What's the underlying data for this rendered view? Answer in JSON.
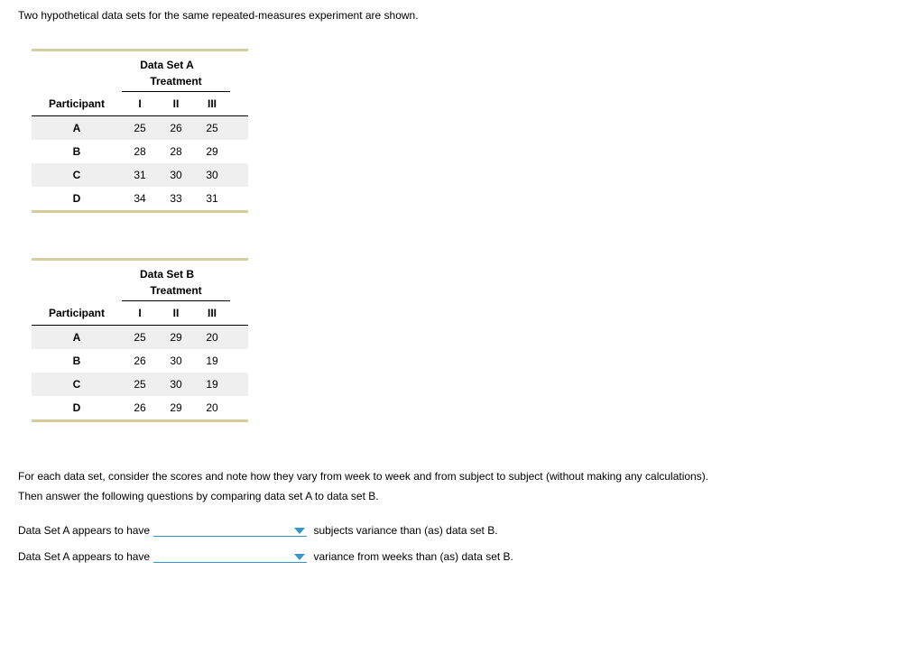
{
  "intro": "Two hypothetical data sets for the same repeated-measures experiment are shown.",
  "datasetA": {
    "title": "Data Set A",
    "treatment_label": "Treatment",
    "participant_label": "Participant",
    "cols": [
      "I",
      "II",
      "III"
    ],
    "rows": [
      {
        "p": "A",
        "v": [
          "25",
          "26",
          "25"
        ]
      },
      {
        "p": "B",
        "v": [
          "28",
          "28",
          "29"
        ]
      },
      {
        "p": "C",
        "v": [
          "31",
          "30",
          "30"
        ]
      },
      {
        "p": "D",
        "v": [
          "34",
          "33",
          "31"
        ]
      }
    ]
  },
  "datasetB": {
    "title": "Data Set B",
    "treatment_label": "Treatment",
    "participant_label": "Participant",
    "cols": [
      "I",
      "II",
      "III"
    ],
    "rows": [
      {
        "p": "A",
        "v": [
          "25",
          "29",
          "20"
        ]
      },
      {
        "p": "B",
        "v": [
          "26",
          "30",
          "19"
        ]
      },
      {
        "p": "C",
        "v": [
          "25",
          "30",
          "19"
        ]
      },
      {
        "p": "D",
        "v": [
          "26",
          "29",
          "20"
        ]
      }
    ]
  },
  "question_text_1": "For each data set, consider the scores and note how they vary from week to week and from subject to subject (without making any calculations).",
  "question_text_2": "Then answer the following questions by comparing data set A to data set B.",
  "fill1_before": "Data Set A appears to have",
  "fill1_after": " subjects variance than (as) data set B.",
  "fill2_before": "Data Set A appears to have",
  "fill2_after": " variance from weeks than (as) data set B."
}
